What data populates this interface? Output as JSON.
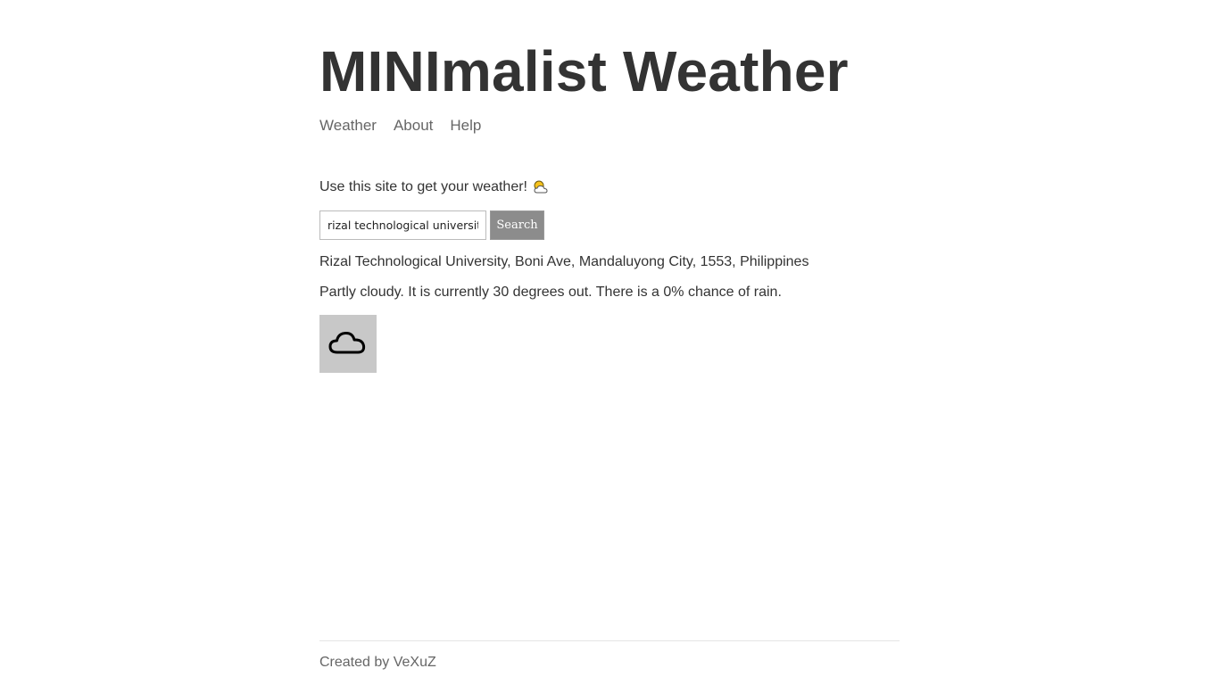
{
  "header": {
    "title": "MINImalist Weather"
  },
  "nav": {
    "items": [
      {
        "label": "Weather"
      },
      {
        "label": "About"
      },
      {
        "label": "Help"
      }
    ]
  },
  "intro": {
    "text": "Use this site to get your weather!",
    "icon": "sun-behind-cloud-icon"
  },
  "search": {
    "value": "rizal technological university",
    "button_label": "Search"
  },
  "result": {
    "location": "Rizal Technological University, Boni Ave, Mandaluyong City, 1553, Philippines",
    "forecast": "Partly cloudy. It is currently 30 degrees out. There is a 0% chance of rain.",
    "icon": "cloud-icon"
  },
  "footer": {
    "text": "Created by VeXuZ"
  },
  "colors": {
    "text": "#333333",
    "muted": "#666666",
    "button": "#8c8c8c",
    "icon_box": "#c8c8c8"
  }
}
